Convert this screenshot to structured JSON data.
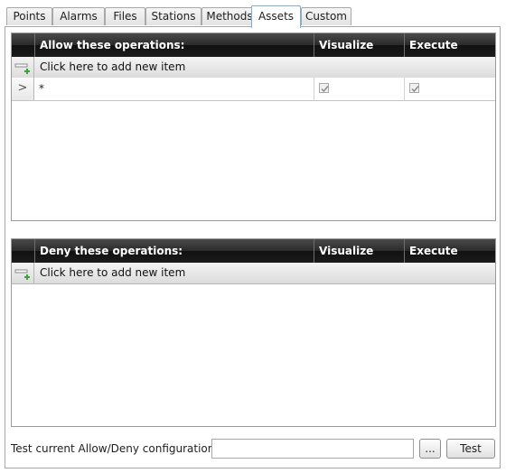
{
  "tabs": [
    {
      "label": "Points"
    },
    {
      "label": "Alarms"
    },
    {
      "label": "Files"
    },
    {
      "label": "Stations"
    },
    {
      "label": "Methods"
    },
    {
      "label": "Assets"
    },
    {
      "label": "Custom"
    }
  ],
  "active_tab": "Assets",
  "allow_grid": {
    "columns": [
      "Allow these operations:",
      "Visualize",
      "Execute"
    ],
    "add_row_text": "Click here to add new item",
    "add_icon": "add-row-icon",
    "rows": [
      {
        "indicator": ">",
        "operation": "*",
        "visualize": true,
        "execute": true
      }
    ]
  },
  "deny_grid": {
    "columns": [
      "Deny these operations:",
      "Visualize",
      "Execute"
    ],
    "add_row_text": "Click here to add new item",
    "add_icon": "add-row-icon",
    "rows": []
  },
  "test": {
    "label": "Test current Allow/Deny configuration:",
    "value": "",
    "browse_label": "...",
    "test_label": "Test"
  }
}
